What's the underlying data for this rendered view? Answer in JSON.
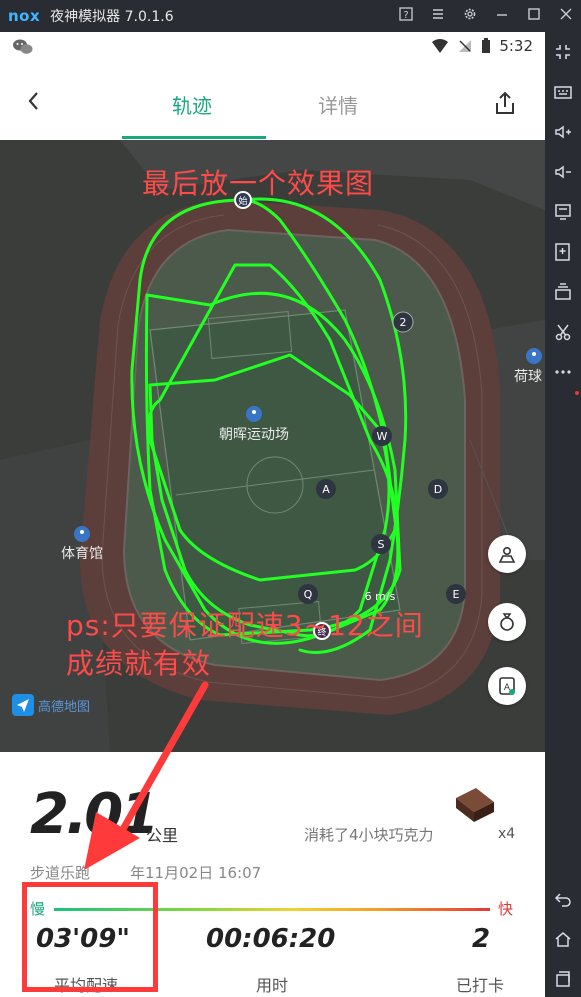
{
  "emulator": {
    "logo": "nox",
    "title": "夜神模拟器 7.0.1.6",
    "icons": [
      "help-icon",
      "menu-icon",
      "settings-icon",
      "minimize-icon",
      "maximize-icon",
      "close-icon"
    ]
  },
  "sidebar": {
    "icons": [
      "exit-fullscreen-icon",
      "keyboard-icon",
      "volume-up-icon",
      "volume-down-icon",
      "screen-icon",
      "apk-install-icon",
      "multi-instance-icon",
      "scissors-icon",
      "more-icon",
      "back-icon",
      "home-icon",
      "recent-apps-icon"
    ]
  },
  "statusbar": {
    "time": "5:32"
  },
  "appbar": {
    "tab_track": "轨迹",
    "tab_detail": "详情"
  },
  "map": {
    "venue_main": "朝晖运动场",
    "venue_left": "体育馆",
    "venue_right": "荷球",
    "start_marker": "始",
    "end_marker": "终",
    "checkpoints": [
      "A",
      "D",
      "W",
      "S",
      "Q",
      "E"
    ],
    "badge_number": "2",
    "speed_label": "6 m/s",
    "provider": "高德地图"
  },
  "annotations": {
    "top_note": "最后放一个效果图",
    "ps_line1": "ps:只要保证配速3~12之间",
    "ps_line2": "成绩就有效"
  },
  "summary": {
    "distance": "2.01",
    "distance_unit": "公里",
    "chocolate_text": "消耗了4小块巧克力",
    "chocolate_count": "x4",
    "run_info": "步道乐跑",
    "run_date": "年11月02日 16:07",
    "pace_slow": "慢",
    "pace_fast": "快"
  },
  "stats": [
    {
      "value": "03'09\"",
      "label": "平均配速"
    },
    {
      "value": "00:06:20",
      "label": "用时"
    },
    {
      "value": "2",
      "label": "已打卡"
    }
  ],
  "colors": {
    "accent": "#18a97e",
    "track_line": "#1fff1f",
    "annotation_red": "#ff4a4a"
  }
}
